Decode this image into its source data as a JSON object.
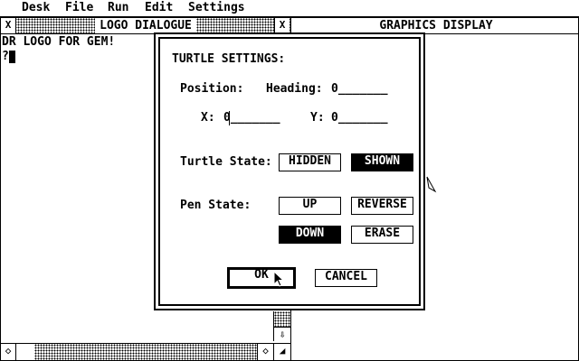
{
  "menubar": {
    "items": [
      "Desk",
      "File",
      "Run",
      "Edit",
      "Settings"
    ]
  },
  "logo_window": {
    "title": "LOGO DIALOGUE",
    "close_glyph": "X",
    "fuller_glyph": "X",
    "lines": [
      "DR LOGO FOR GEM!",
      "?"
    ],
    "scroll_left_glyph": "◇",
    "scroll_right_glyph": "◇",
    "scroll_down_glyph": "⇩",
    "size_glyph": "◢"
  },
  "graphics_window": {
    "title": "GRAPHICS DISPLAY"
  },
  "dialog": {
    "title": "TURTLE SETTINGS:",
    "position_label": "Position:",
    "heading_label": "Heading:",
    "heading_value": "0_______",
    "x_label": "X:",
    "x_value": "0_______",
    "y_label": "Y:",
    "y_value": "0_______",
    "turtle_state_label": "Turtle State:",
    "hidden_label": "HIDDEN",
    "shown_label": "SHOWN",
    "pen_state_label": "Pen State:",
    "up_label": "UP",
    "reverse_label": "REVERSE",
    "down_label": "DOWN",
    "erase_label": "ERASE",
    "ok_label": "OK",
    "cancel_label": "CANCEL"
  }
}
